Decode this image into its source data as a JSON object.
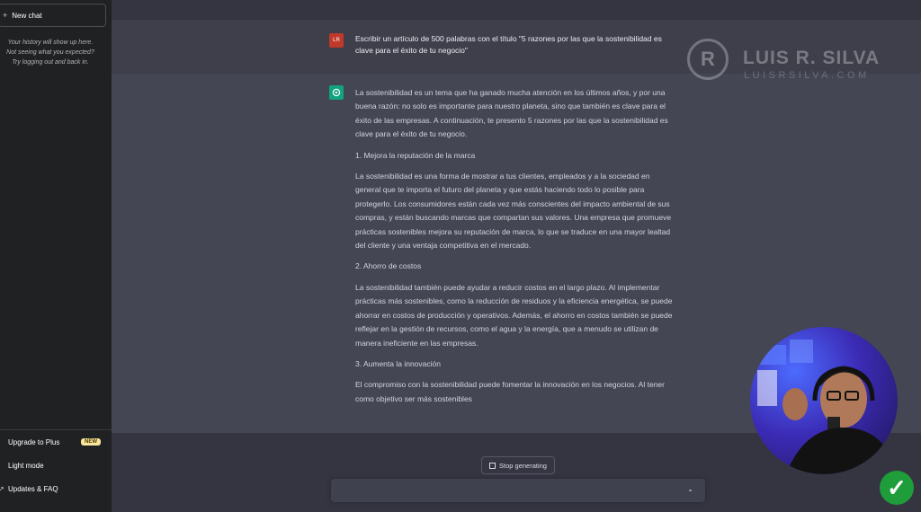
{
  "sidebar": {
    "new_chat_label": "New chat",
    "history_note": [
      "Your history will show up here.",
      "Not seeing what you expected?",
      "Try logging out and back in."
    ],
    "upgrade_label": "Upgrade to Plus",
    "new_badge": "NEW",
    "light_mode_label": "Light mode",
    "updates_label": "Updates & FAQ"
  },
  "conversation": {
    "user_avatar_initials": "LR",
    "user_prompt": "Escribir un artículo de 500 palabras con el título \"5 razones por las que la sostenibilidad es clave para el éxito de tu negocio\"",
    "answer": {
      "intro": "La sostenibilidad es un tema que ha ganado mucha atención en los últimos años, y por una buena razón: no solo es importante para nuestro planeta, sino que también es clave para el éxito de las empresas. A continuación, te presento 5 razones por las que la sostenibilidad es clave para el éxito de tu negocio.",
      "h1": "1.   Mejora la reputación de la marca",
      "p1": "La sostenibilidad es una forma de mostrar a tus clientes, empleados y a la sociedad en general que te importa el futuro del planeta y que estás haciendo todo lo posible para protegerlo. Los consumidores están cada vez más conscientes del impacto ambiental de sus compras, y están buscando marcas que compartan sus valores. Una empresa que promueve prácticas sostenibles mejora su reputación de marca, lo que se traduce en una mayor lealtad del cliente y una ventaja competitiva en el mercado.",
      "h2": "2.   Ahorro de costos",
      "p2": "La sostenibilidad también puede ayudar a reducir costos en el largo plazo. Al implementar prácticas más sostenibles, como la reducción de residuos y la eficiencia energética, se puede ahorrar en costos de producción y operativos. Además, el ahorro en costos también se puede reflejar en la gestión de recursos, como el agua y la energía, que a menudo se utilizan de manera ineficiente en las empresas.",
      "h3": "3.   Aumenta la innovación",
      "p3": "El compromiso con la sostenibilidad puede fomentar la innovación en los negocios. Al tener como objetivo ser más sostenibles"
    }
  },
  "composer": {
    "stop_label": "Stop generating"
  },
  "watermark": {
    "logo_letter": "R",
    "name": "LUIS R. SILVA",
    "site": "LUISRSILVA.COM"
  },
  "colors": {
    "sidebar_bg": "#202123",
    "user_row_bg": "#3e3f4b",
    "assistant_row_bg": "#444654",
    "gpt_green": "#10a37f",
    "check_green": "#1f9d3a"
  }
}
